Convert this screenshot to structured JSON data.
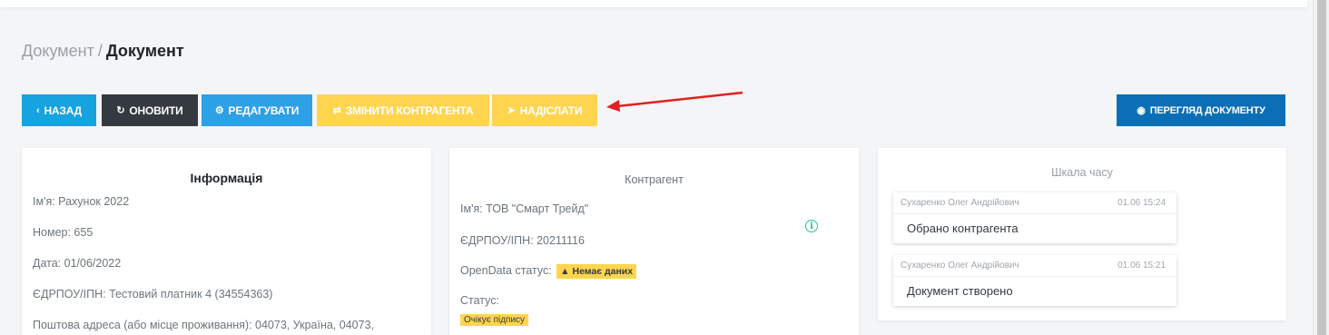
{
  "breadcrumb": {
    "parent": "Документ",
    "separator": "/",
    "current": "Документ"
  },
  "toolbar": {
    "back_label": "НАЗАД",
    "refresh_label": "ОНОВИТИ",
    "edit_label": "РЕДАГУВАТИ",
    "change_contractor_label": "ЗМІНИТИ КОНТРАГЕНТА",
    "send_label": "НАДІСЛАТИ",
    "view_document_label": "ПЕРЕГЛЯД ДОКУМЕНТУ"
  },
  "info": {
    "title": "Інформація",
    "name": "Ім'я: Рахунок 2022",
    "number": "Номер: 655",
    "date": "Дата: 01/06/2022",
    "edrpou": "ЄДРПОУ/ІПН: Тестовий платник 4 (34554363)",
    "address": "Поштова адреса (або місце проживання): 04073, Україна, 04073,"
  },
  "contractor": {
    "title": "Контрагент",
    "name": "Ім'я: ТОВ \"Смарт Трейд\"",
    "edrpou": "ЄДРПОУ/ІПН: 20211116",
    "opendata_label": "OpenData статус:",
    "opendata_badge": "Немає даних",
    "status_label": "Статус:",
    "status_badge": "Очікує підпису",
    "info_icon": "info-circle-icon"
  },
  "timeline": {
    "title": "Шкала часу",
    "events": [
      {
        "user": "Сухаренко Олег Андрійович",
        "time": "01.06 15:24",
        "text": "Обрано контрагента"
      },
      {
        "user": "Сухаренко Олег Андрійович",
        "time": "01.06 15:21",
        "text": "Документ створено"
      }
    ]
  },
  "icons": {
    "back": "chevron-left-icon",
    "refresh": "refresh-icon",
    "edit": "gear-icon",
    "change": "swap-icon",
    "send": "paper-plane-icon",
    "view": "eye-icon",
    "warning": "warning-triangle-icon"
  },
  "colors": {
    "primary": "#2ea0e6",
    "dark": "#343a40",
    "warning": "#ffd54f",
    "view_button": "#0a6fb5",
    "annotation_arrow": "#e02020"
  }
}
